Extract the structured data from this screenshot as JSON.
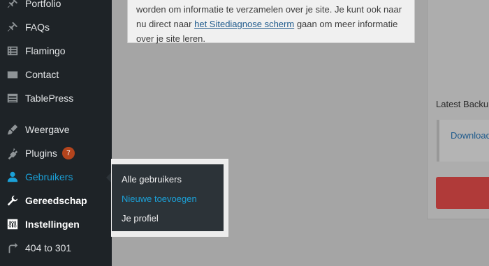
{
  "sidebar": {
    "items": [
      {
        "label": "Portfolio",
        "icon": "pin-icon"
      },
      {
        "label": "FAQs",
        "icon": "pin-icon"
      },
      {
        "label": "Flamingo",
        "icon": "list-icon"
      },
      {
        "label": "Contact",
        "icon": "mail-icon"
      },
      {
        "label": "TablePress",
        "icon": "table-icon"
      },
      {
        "label": "Weergave",
        "icon": "brush-icon"
      },
      {
        "label": "Plugins",
        "icon": "plug-icon",
        "badge": "7"
      },
      {
        "label": "Gebruikers",
        "icon": "user-icon"
      },
      {
        "label": "Gereedschap",
        "icon": "wrench-icon"
      },
      {
        "label": "Instellingen",
        "icon": "sliders-icon"
      },
      {
        "label": "404 to 301",
        "icon": "redirect-icon"
      }
    ]
  },
  "flyout": {
    "items": [
      {
        "label": "Alle gebruikers"
      },
      {
        "label": "Nieuwe toevoegen"
      },
      {
        "label": "Je profiel"
      }
    ]
  },
  "notice": {
    "line1": "worden om informatie te verzamelen over je site. Je kunt ook naar",
    "line2_before": "nu direct naar ",
    "line2_link": "het Sitediagnose scherm",
    "line2_after": " gaan om meer informatie",
    "line3": "over je site leren."
  },
  "backup": {
    "title": "Latest Backup",
    "download_label": "Download"
  },
  "colors": {
    "sidebar_bg": "#1e2327",
    "accent": "#1ba1d8",
    "badge": "#b3441d",
    "button_red": "#b03a39"
  }
}
